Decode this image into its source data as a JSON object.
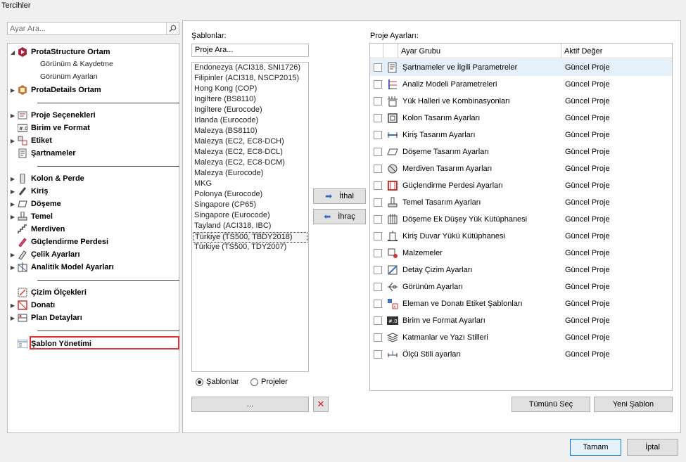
{
  "window": {
    "title": "Tercihler"
  },
  "left": {
    "search_placeholder": "Ayar Ara...",
    "tree": {
      "prota_structure": "ProtaStructure Ortam",
      "sub_save": "Görünüm & Kaydetme",
      "sub_view": "Görünüm Ayarları",
      "prota_details": "ProtaDetails Ortam",
      "proje": "Proje Seçenekleri",
      "birim": "Birim ve Format",
      "etiket": "Etiket",
      "sartname": "Şartnameler",
      "kolon": "Kolon & Perde",
      "kiris": "Kiriş",
      "doseme": "Döşeme",
      "temel": "Temel",
      "merdiven": "Merdiven",
      "perde": "Güçlendirme Perdesi",
      "celik": "Çelik Ayarları",
      "analitik": "Analitik Model Ayarları",
      "cizim": "Çizim Ölçekleri",
      "donati": "Donatı",
      "plan": "Plan Detayları",
      "sablon": "Şablon Yönetimi"
    }
  },
  "templates": {
    "label": "Şablonlar:",
    "search_placeholder": "Proje Ara...",
    "items": [
      "Endonezya (ACI318, SNI1726)",
      "Filipinler (ACI318, NSCP2015)",
      "Hong Kong (COP)",
      "Ingiltere (BS8110)",
      "Ingiltere (Eurocode)",
      "Irlanda (Eurocode)",
      "Malezya (BS8110)",
      "Malezya (EC2, EC8-DCH)",
      "Malezya (EC2, EC8-DCL)",
      "Malezya (EC2, EC8-DCM)",
      "Malezya (Eurocode)",
      "MKG",
      "Polonya (Eurocode)",
      "Singapore (CP65)",
      "Singapore (Eurocode)",
      "Tayland (ACI318, IBC)",
      "Türkiye (TS500, TBDY2018)",
      "Türkiye (TS500, TDY2007)"
    ],
    "radio_templates": "Şablonlar",
    "radio_projects": "Projeler",
    "browse_label": "...",
    "import_label": "İthal",
    "export_label": "İhraç"
  },
  "project_settings": {
    "label": "Proje Ayarları:",
    "col_group": "Ayar Grubu",
    "col_value": "Aktif Değer",
    "rows": [
      {
        "name": "Şartnameler ve İlgili Parametreler",
        "value": "Güncel Proje"
      },
      {
        "name": "Analiz Modeli Parametreleri",
        "value": "Güncel Proje"
      },
      {
        "name": "Yük Halleri ve Kombinasyonları",
        "value": "Güncel Proje"
      },
      {
        "name": "Kolon Tasarım Ayarları",
        "value": "Güncel Proje"
      },
      {
        "name": "Kiriş Tasarım Ayarları",
        "value": "Güncel Proje"
      },
      {
        "name": "Döşeme Tasarım Ayarları",
        "value": "Güncel Proje"
      },
      {
        "name": "Merdiven Tasarım Ayarları",
        "value": "Güncel Proje"
      },
      {
        "name": "Güçlendirme Perdesi Ayarları",
        "value": "Güncel Proje"
      },
      {
        "name": "Temel Tasarım Ayarları",
        "value": "Güncel Proje"
      },
      {
        "name": "Döşeme Ek Düşey Yük Kütüphanesi",
        "value": "Güncel Proje"
      },
      {
        "name": "Kiriş Duvar Yükü Kütüphanesi",
        "value": "Güncel Proje"
      },
      {
        "name": "Malzemeler",
        "value": "Güncel Proje"
      },
      {
        "name": "Detay Çizim Ayarları",
        "value": "Güncel Proje"
      },
      {
        "name": "Görünüm Ayarları",
        "value": "Güncel Proje"
      },
      {
        "name": "Eleman ve Donatı Etiket Şablonları",
        "value": "Güncel Proje"
      },
      {
        "name": "Birim ve Format Ayarları",
        "value": "Güncel Proje"
      },
      {
        "name": "Katmanlar ve Yazı Stilleri",
        "value": "Güncel Proje"
      },
      {
        "name": "Ölçü Stili ayarları",
        "value": "Güncel Proje"
      }
    ],
    "select_all": "Tümünü Seç",
    "new_template": "Yeni Şablon"
  },
  "footer": {
    "ok": "Tamam",
    "cancel": "İptal"
  }
}
